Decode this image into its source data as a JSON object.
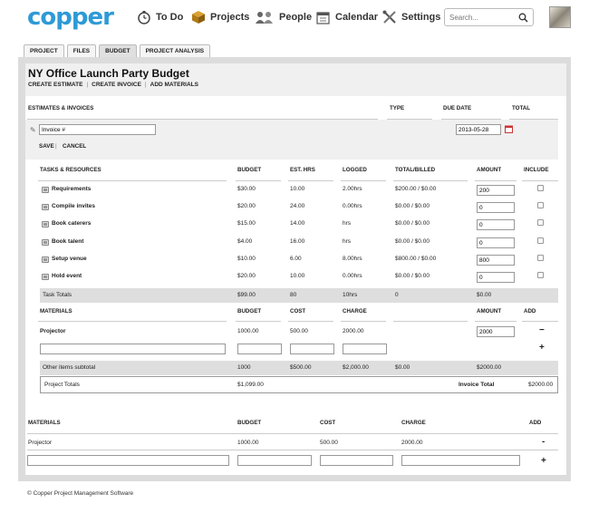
{
  "header": {
    "logo": "copper",
    "nav": [
      {
        "label": "To Do",
        "icon": "stopwatch-icon"
      },
      {
        "label": "Projects",
        "icon": "box-icon"
      },
      {
        "label": "People",
        "icon": "people-icon"
      },
      {
        "label": "Calendar",
        "icon": "calendar-icon"
      },
      {
        "label": "Settings",
        "icon": "tools-icon"
      }
    ],
    "search_placeholder": "Search..."
  },
  "tabs": [
    "PROJECT",
    "FILES",
    "BUDGET",
    "PROJECT ANALYSIS"
  ],
  "page": {
    "title": "NY Office Launch Party Budget",
    "actions": [
      "CREATE ESTIMATE",
      "CREATE INVOICE",
      "ADD MATERIALS"
    ]
  },
  "estimates": {
    "headers": {
      "section": "ESTIMATES & INVOICES",
      "type": "TYPE",
      "due": "DUE DATE",
      "total": "TOTAL"
    },
    "invoice_value": "Invoice #",
    "due_value": "2013-05-28",
    "save": "SAVE",
    "cancel": "CANCEL"
  },
  "tasks": {
    "headers": {
      "name": "TASKS & RESOURCES",
      "budget": "BUDGET",
      "est": "EST. HRS",
      "logged": "LOGGED",
      "billed": "TOTAL/BILLED",
      "amount": "AMOUNT",
      "include": "INCLUDE"
    },
    "rows": [
      {
        "name": "Requirements",
        "budget": "$30.00",
        "est": "10.00",
        "logged": "2.00hrs",
        "billed": "$200.00 / $0.00",
        "amount": "200"
      },
      {
        "name": "Compile invites",
        "budget": "$20.00",
        "est": "24.00",
        "logged": "0.00hrs",
        "billed": "$0.00 / $0.00",
        "amount": "0"
      },
      {
        "name": "Book caterers",
        "budget": "$15.00",
        "est": "14.00",
        "logged": "hrs",
        "billed": "$0.00 / $0.00",
        "amount": "0"
      },
      {
        "name": "Book talent",
        "budget": "$4.00",
        "est": "16.00",
        "logged": "hrs",
        "billed": "$0.00 / $0.00",
        "amount": "0"
      },
      {
        "name": "Setup venue",
        "budget": "$10.00",
        "est": "6.00",
        "logged": "8.00hrs",
        "billed": "$800.00 / $0.00",
        "amount": "800"
      },
      {
        "name": "Hold event",
        "budget": "$20.00",
        "est": "10.00",
        "logged": "0.00hrs",
        "billed": "$0.00 / $0.00",
        "amount": "0"
      }
    ],
    "totals": {
      "label": "Task Totals",
      "budget": "$99.00",
      "est": "80",
      "logged": "10hrs",
      "billed": "0",
      "amount": "$0.00"
    }
  },
  "materials_inner": {
    "headers": {
      "name": "MATERIALS",
      "budget": "BUDGET",
      "cost": "COST",
      "charge": "CHARGE",
      "amount": "AMOUNT",
      "add": "ADD"
    },
    "row": {
      "name": "Projector",
      "budget": "1000.00",
      "cost": "500.00",
      "charge": "2000.00",
      "amount": "2000"
    },
    "remove": "−",
    "add": "+",
    "subtotal": {
      "label": "Other items subtotal",
      "budget": "1000",
      "cost": "$500.00",
      "charge": "$2,000.00",
      "billed": "$0.00",
      "amount": "$2000.00"
    }
  },
  "project_totals": {
    "label": "Project Totals",
    "budget": "$1,099.00",
    "invoice_label": "Invoice Total",
    "invoice_value": "$2000.00"
  },
  "materials_outer": {
    "headers": {
      "name": "MATERIALS",
      "budget": "BUDGET",
      "cost": "COST",
      "charge": "CHARGE",
      "add": "ADD"
    },
    "row": {
      "name": "Projector",
      "budget": "1000.00",
      "cost": "500.00",
      "charge": "2000.00"
    },
    "remove": "-",
    "add": "+"
  },
  "footer": "© Copper Project Management Software"
}
